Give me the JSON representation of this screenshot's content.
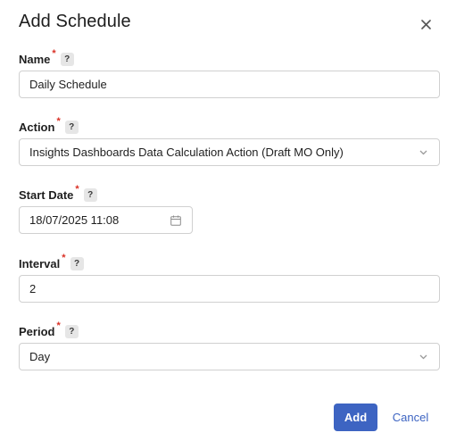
{
  "dialog": {
    "title": "Add Schedule",
    "close_icon": "close-icon"
  },
  "fields": {
    "name": {
      "label": "Name",
      "required_mark": "*",
      "help": "?",
      "value": "Daily Schedule"
    },
    "action": {
      "label": "Action",
      "required_mark": "*",
      "help": "?",
      "value": "Insights Dashboards Data Calculation Action (Draft MO Only)",
      "trailing_icon": "chevron-down-icon"
    },
    "start_date": {
      "label": "Start Date",
      "required_mark": "*",
      "help": "?",
      "value": "18/07/2025 11:08",
      "trailing_icon": "calendar-icon"
    },
    "interval": {
      "label": "Interval",
      "required_mark": "*",
      "help": "?",
      "value": "2"
    },
    "period": {
      "label": "Period",
      "required_mark": "*",
      "help": "?",
      "value": "Day",
      "trailing_icon": "chevron-down-icon"
    }
  },
  "footer": {
    "add_label": "Add",
    "cancel_label": "Cancel"
  },
  "colors": {
    "primary": "#3d64c2",
    "required": "#d93025",
    "border": "#d0d0d0",
    "help_bg": "#e6e6e6"
  }
}
